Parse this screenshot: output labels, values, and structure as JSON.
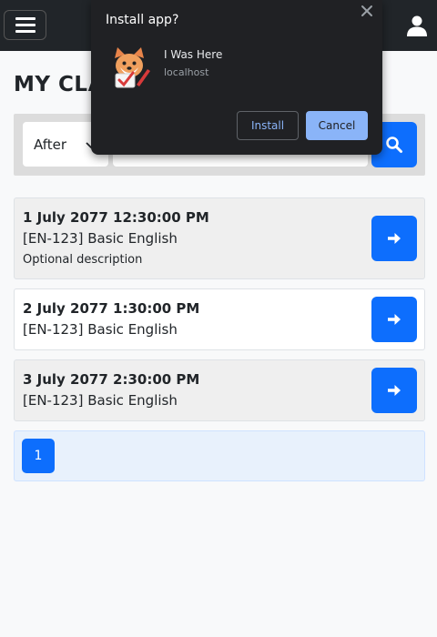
{
  "header": {
    "menu_icon": "hamburger-icon",
    "user_icon": "user-icon"
  },
  "page": {
    "title": "MY CLASSES"
  },
  "filter": {
    "select_value": "After",
    "date_value": "",
    "search_icon": "search-icon"
  },
  "sessions": [
    {
      "datetime": "1 July 2077 12:30:00 PM",
      "class_name": "[EN-123] Basic English",
      "description": "Optional description"
    },
    {
      "datetime": "2 July 2077 1:30:00 PM",
      "class_name": "[EN-123] Basic English"
    },
    {
      "datetime": "3 July 2077 2:30:00 PM",
      "class_name": "[EN-123] Basic English"
    }
  ],
  "pagination": {
    "current_page": "1"
  },
  "install_dialog": {
    "title": "Install app?",
    "app_name": "I Was Here",
    "origin": "localhost",
    "install_label": "Install",
    "cancel_label": "Cancel"
  },
  "colors": {
    "primary": "#0d6efd",
    "navbar": "#212529",
    "dialog_bg": "#202124",
    "dialog_accent": "#8ab4f8"
  }
}
